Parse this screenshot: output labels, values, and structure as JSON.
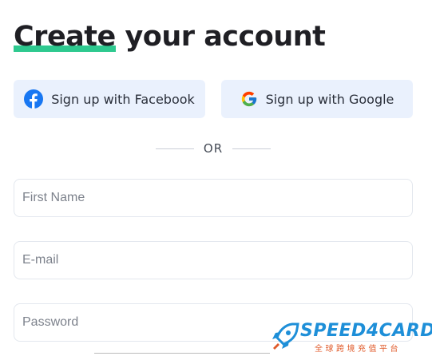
{
  "heading": {
    "highlight": "Create",
    "rest": " your account"
  },
  "social": {
    "facebook_label": "Sign up with Facebook",
    "google_label": "Sign up with Google"
  },
  "divider_label": "OR",
  "fields": {
    "first_name_placeholder": "First Name",
    "email_placeholder": "E-mail",
    "password_placeholder": "Password"
  },
  "watermark": {
    "brand": "SPEED4CARD",
    "tagline": "全球跨境充值平台"
  },
  "colors": {
    "accent": "#2ec98f",
    "button_bg": "#eaf1fd",
    "facebook": "#1877f2",
    "watermark_blue": "#1e8fd8",
    "watermark_orange": "#e05a2a"
  },
  "icons": [
    "facebook-icon",
    "google-icon",
    "rocket-icon"
  ]
}
